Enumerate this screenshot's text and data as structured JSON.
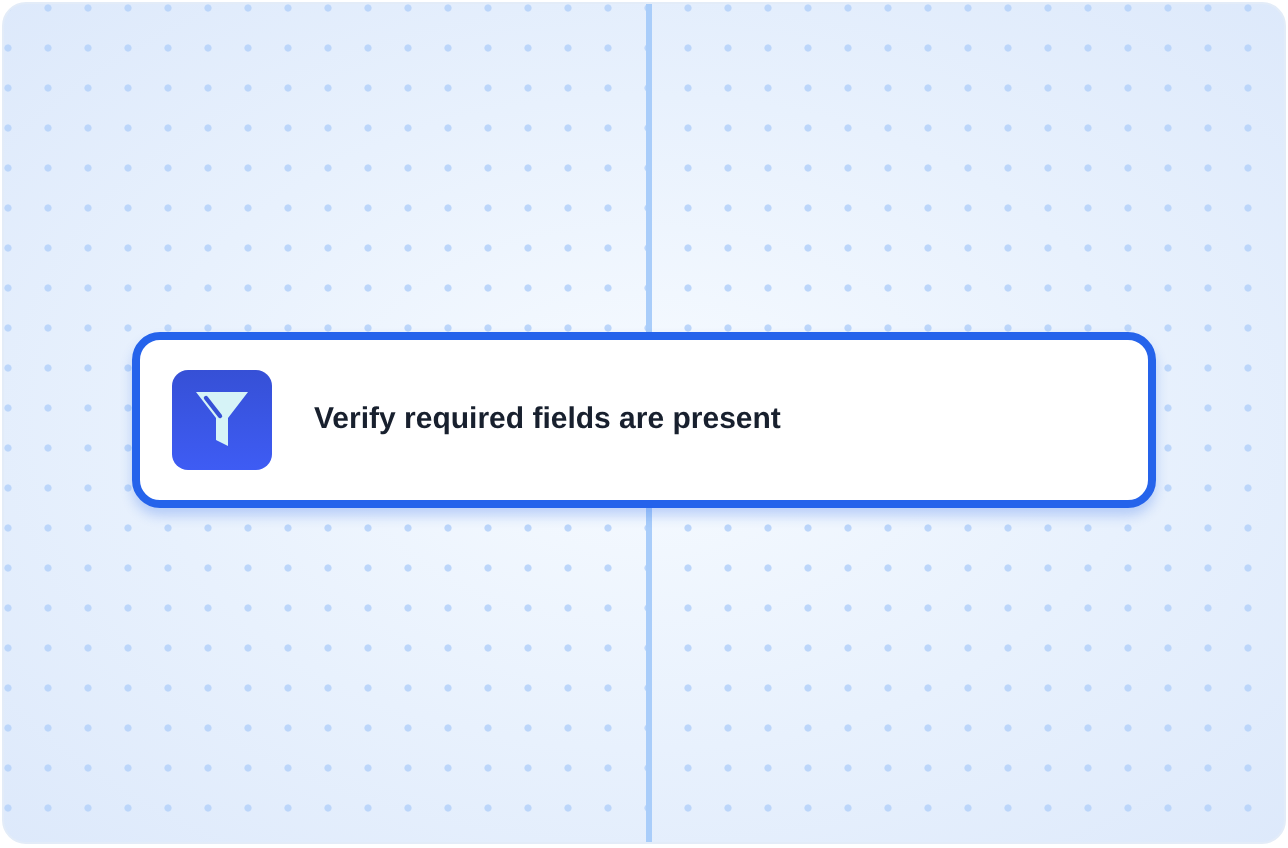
{
  "node": {
    "label": "Verify required fields are present",
    "selected": true
  }
}
